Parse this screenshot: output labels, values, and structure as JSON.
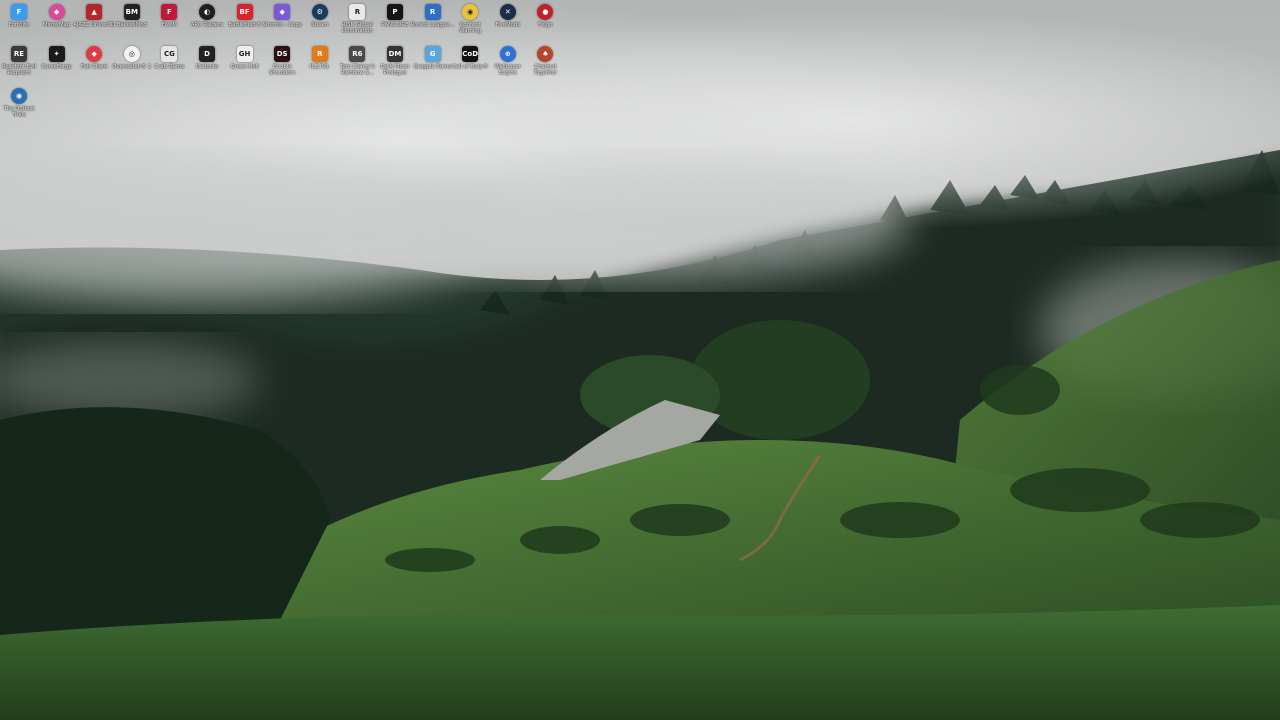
{
  "desktop": {
    "icons": [
      {
        "label": "Fortnite",
        "icon": "fortnite-icon",
        "bg": "#3a9bf0",
        "glyph": "F",
        "round": false
      },
      {
        "label": "MinnyMap",
        "icon": "minnymap-icon",
        "bg": "#d84b9a",
        "glyph": "◆",
        "round": true
      },
      {
        "label": "AJAZZ DriverCD",
        "icon": "ajazz-icon",
        "bg": "#b3262c",
        "glyph": "▲",
        "round": false
      },
      {
        "label": "BakkesMod",
        "icon": "bakkesmod-icon",
        "bg": "#222222",
        "glyph": "BM",
        "round": false
      },
      {
        "label": "FiveM",
        "icon": "fivem-icon",
        "bg": "#c2183b",
        "glyph": "F",
        "round": false
      },
      {
        "label": "ARC Raiders",
        "icon": "arc-raiders-icon",
        "bg": "#1f1f1f",
        "glyph": "◐",
        "round": true
      },
      {
        "label": "Battlefield 6",
        "icon": "battlefield-icon",
        "bg": "#d8242c",
        "glyph": "BF",
        "round": false
      },
      {
        "label": "Stremio - Copy",
        "icon": "stremio-icon",
        "bg": "#7b5ad6",
        "glyph": "◆",
        "round": false
      },
      {
        "label": "Steam",
        "icon": "steam-icon",
        "bg": "#1b3b5e",
        "glyph": "⚙",
        "round": true
      },
      {
        "label": "RISK Global Domination",
        "icon": "risk-icon",
        "bg": "#e8e8e8",
        "glyph": "R",
        "round": false
      },
      {
        "label": "PANICORE",
        "icon": "panicore-icon",
        "bg": "#151515",
        "glyph": "P",
        "round": false
      },
      {
        "label": "Rocket League...",
        "icon": "rocket-league-icon",
        "bg": "#2d6fc4",
        "glyph": "R",
        "round": false
      },
      {
        "label": "Content Warning",
        "icon": "content-warning-icon",
        "bg": "#e9c43a",
        "glyph": "◉",
        "round": true
      },
      {
        "label": "FiveMods",
        "icon": "fivemods-icon",
        "bg": "#1c2d4a",
        "glyph": "✕",
        "round": true
      },
      {
        "label": "Feign",
        "icon": "feign-icon",
        "bg": "#c0222b",
        "glyph": "●",
        "round": true
      },
      {
        "label": "Resident Evil Requiem",
        "icon": "resident-evil-icon",
        "bg": "#3a3a3a",
        "glyph": "RE",
        "round": false
      },
      {
        "label": "CurseForge",
        "icon": "curseforge-icon",
        "bg": "#1a1a1a",
        "glyph": "✦",
        "round": false
      },
      {
        "label": "Feit Client",
        "icon": "feit-client-icon",
        "bg": "#e03a44",
        "glyph": "◆",
        "round": true
      },
      {
        "label": "Overwatch® 2",
        "icon": "overwatch-icon",
        "bg": "#f2f2f2",
        "glyph": "◎",
        "round": true
      },
      {
        "label": "Crab Game",
        "icon": "crab-game-icon",
        "bg": "#e5e5e5",
        "glyph": "CG",
        "round": false
      },
      {
        "label": "Deducto",
        "icon": "deducto-icon",
        "bg": "#222222",
        "glyph": "D",
        "round": false
      },
      {
        "label": "Green Hell",
        "icon": "green-hell-icon",
        "bg": "#eeeeee",
        "glyph": "GH",
        "round": false
      },
      {
        "label": "Double Shoulders",
        "icon": "double-shoulders-icon",
        "bg": "#2a0f10",
        "glyph": "DS",
        "round": false
      },
      {
        "label": "R.E.P.O.",
        "icon": "repo-icon",
        "bg": "#e07a1a",
        "glyph": "R",
        "round": false
      },
      {
        "label": "Tom Clancy's Rainbow S...",
        "icon": "rainbow-six-icon",
        "bg": "#4a4a4a",
        "glyph": "R6",
        "round": false
      },
      {
        "label": "Dark Moon Prologue",
        "icon": "dark-moon-icon",
        "bg": "#333333",
        "glyph": "DM",
        "round": false
      },
      {
        "label": "Grapple Rome",
        "icon": "grapple-rome-icon",
        "bg": "#5fa4d8",
        "glyph": "G",
        "round": false
      },
      {
        "label": "Call of Duty®",
        "icon": "call-of-duty-icon",
        "bg": "#111111",
        "glyph": "CoD",
        "round": false
      },
      {
        "label": "Wallpaper Engine",
        "icon": "wallpaper-engine-icon",
        "bg": "#2f6fd6",
        "glyph": "⊕",
        "round": true
      },
      {
        "label": "Chained Together",
        "icon": "chained-together-icon",
        "bg": "#b3462c",
        "glyph": "♠",
        "round": true
      },
      {
        "label": "The Outlast Trials",
        "icon": "outlast-trials-icon",
        "bg": "#2b6fb0",
        "glyph": "◉",
        "round": true
      }
    ]
  },
  "wallpaper": {
    "sky_top": "#a9adaa",
    "fog": "#d8dadb",
    "forest_dark": "#1c2b22",
    "hill_green": "#3b6b34",
    "grass": "#2f5a26"
  }
}
